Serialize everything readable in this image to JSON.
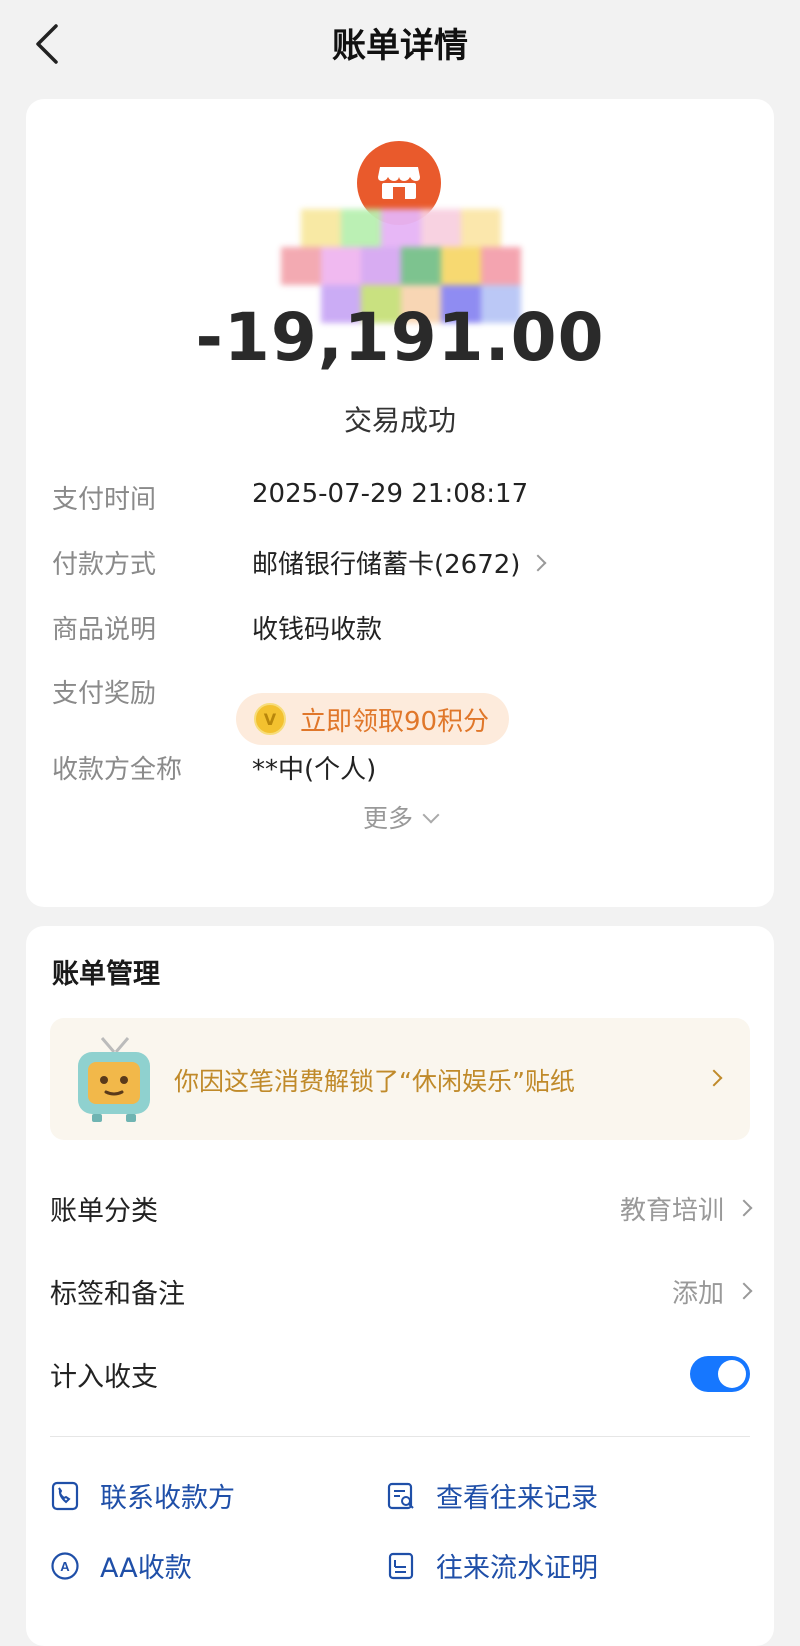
{
  "header": {
    "title": "账单详情"
  },
  "transaction": {
    "amount": "-19,191.00",
    "status": "交易成功"
  },
  "details": [
    {
      "label": "支付时间",
      "value": "2025-07-29 21:08:17"
    },
    {
      "label": "付款方式",
      "value": "邮储银行储蓄卡(2672)"
    },
    {
      "label": "商品说明",
      "value": "收钱码收款"
    },
    {
      "label": "支付奖励",
      "value": "立即领取90积分"
    },
    {
      "label": "收款方全称",
      "value": "**中(个人)"
    }
  ],
  "more_label": "更多",
  "bill_management": {
    "title": "账单管理",
    "sticker_banner": "你因这笔消费解锁了“休闲娱乐”贴纸",
    "category_label": "账单分类",
    "category_value": "教育培训",
    "tags_label": "标签和备注",
    "tags_value": "添加",
    "include_label": "计入收支",
    "include_enabled": true
  },
  "actions": [
    {
      "label": "联系收款方",
      "icon": "phone-icon"
    },
    {
      "label": "查看往来记录",
      "icon": "records-search-icon"
    },
    {
      "label": "AA收款",
      "icon": "aa-icon"
    },
    {
      "label": "往来流水证明",
      "icon": "statement-icon"
    }
  ],
  "colors": {
    "accent_blue": "#1677ff",
    "merchant_orange": "#e95a2c",
    "reward_orange": "#e0772a"
  }
}
